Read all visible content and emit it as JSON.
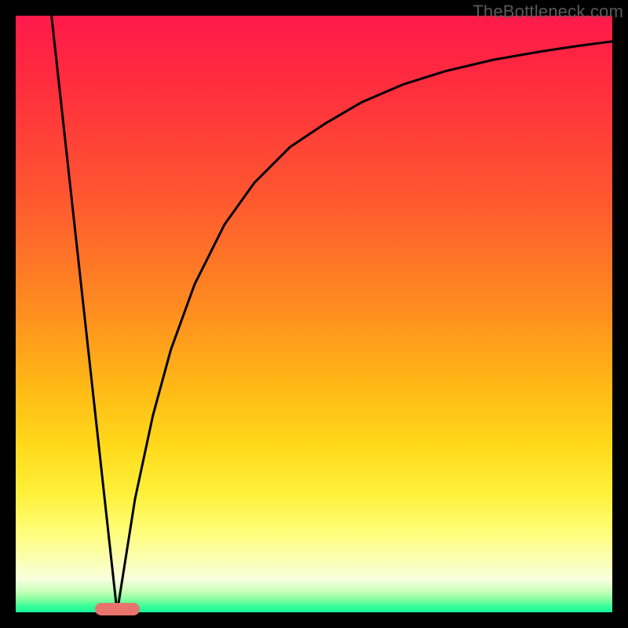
{
  "watermark": "TheBottleneck.com",
  "colors": {
    "frame": "#000000",
    "curve": "#000000",
    "marker": "#e8746d",
    "gradient_top": "#ff1a4b",
    "gradient_bottom": "#18f99a"
  },
  "chart_data": {
    "type": "line",
    "title": "",
    "xlabel": "",
    "ylabel": "",
    "xlim": [
      0,
      100
    ],
    "ylim": [
      0,
      100
    ],
    "grid": false,
    "legend": false,
    "annotations": [],
    "marker": {
      "x_center": 17,
      "width": 7.5,
      "y": 0.5
    },
    "series": [
      {
        "name": "left-line",
        "x": [
          6,
          17
        ],
        "y": [
          100,
          0
        ]
      },
      {
        "name": "right-curve",
        "x": [
          17,
          20,
          23,
          26,
          30,
          35,
          40,
          46,
          52,
          58,
          65,
          72,
          80,
          88,
          94,
          100
        ],
        "y": [
          0,
          19,
          33,
          44,
          55,
          65,
          72,
          78,
          82,
          85.5,
          88.5,
          90.7,
          92.6,
          94.0,
          94.9,
          95.7
        ]
      }
    ]
  }
}
